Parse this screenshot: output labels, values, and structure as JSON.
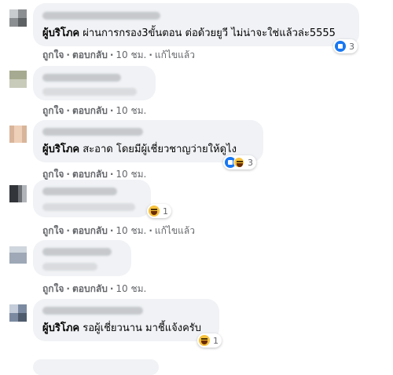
{
  "comments": [
    {
      "author": "ผู้บริโภค",
      "text": "ผ่านการกรอง3ขั้นตอน ต่อด้วยยูวี ไม่น่าจะใช่แล้วล่ะ5555",
      "reactions": {
        "icons": [
          "like-icon"
        ],
        "count": "3"
      },
      "actions": {
        "like": "ถูกใจ",
        "reply": "ตอบกลับ",
        "time": "10 ชม.",
        "edited": "แก้ไขแล้ว"
      }
    },
    {
      "actions": {
        "like": "ถูกใจ",
        "reply": "ตอบกลับ",
        "time": "10 ชม."
      }
    },
    {
      "author": "ผู้บริโภค",
      "text": "สะอาด โดยมีผู้เชี่ยวชาญว่ายให้ดูไง",
      "reactions": {
        "icons": [
          "like-icon",
          "haha-icon"
        ],
        "count": "3"
      },
      "actions": {
        "like": "ถูกใจ",
        "reply": "ตอบกลับ",
        "time": "10 ชม."
      }
    },
    {
      "reactions": {
        "icons": [
          "haha-icon"
        ],
        "count": "1"
      },
      "actions": {
        "like": "ถูกใจ",
        "reply": "ตอบกลับ",
        "time": "10 ชม.",
        "edited": "แก้ไขแล้ว"
      }
    },
    {
      "actions": {
        "like": "ถูกใจ",
        "reply": "ตอบกลับ",
        "time": "10 ชม."
      }
    },
    {
      "author": "ผู้บริโภค",
      "text": "รอผู้เชี่ยวนาน มาชี้แจ้งครับ",
      "reactions": {
        "icons": [
          "haha-icon"
        ],
        "count": "1"
      }
    }
  ],
  "separator": "·",
  "colors": {
    "bubble": "#f0f2f5",
    "meta": "#65676b",
    "like": "#1877f2",
    "haha": "#f7c23e"
  }
}
